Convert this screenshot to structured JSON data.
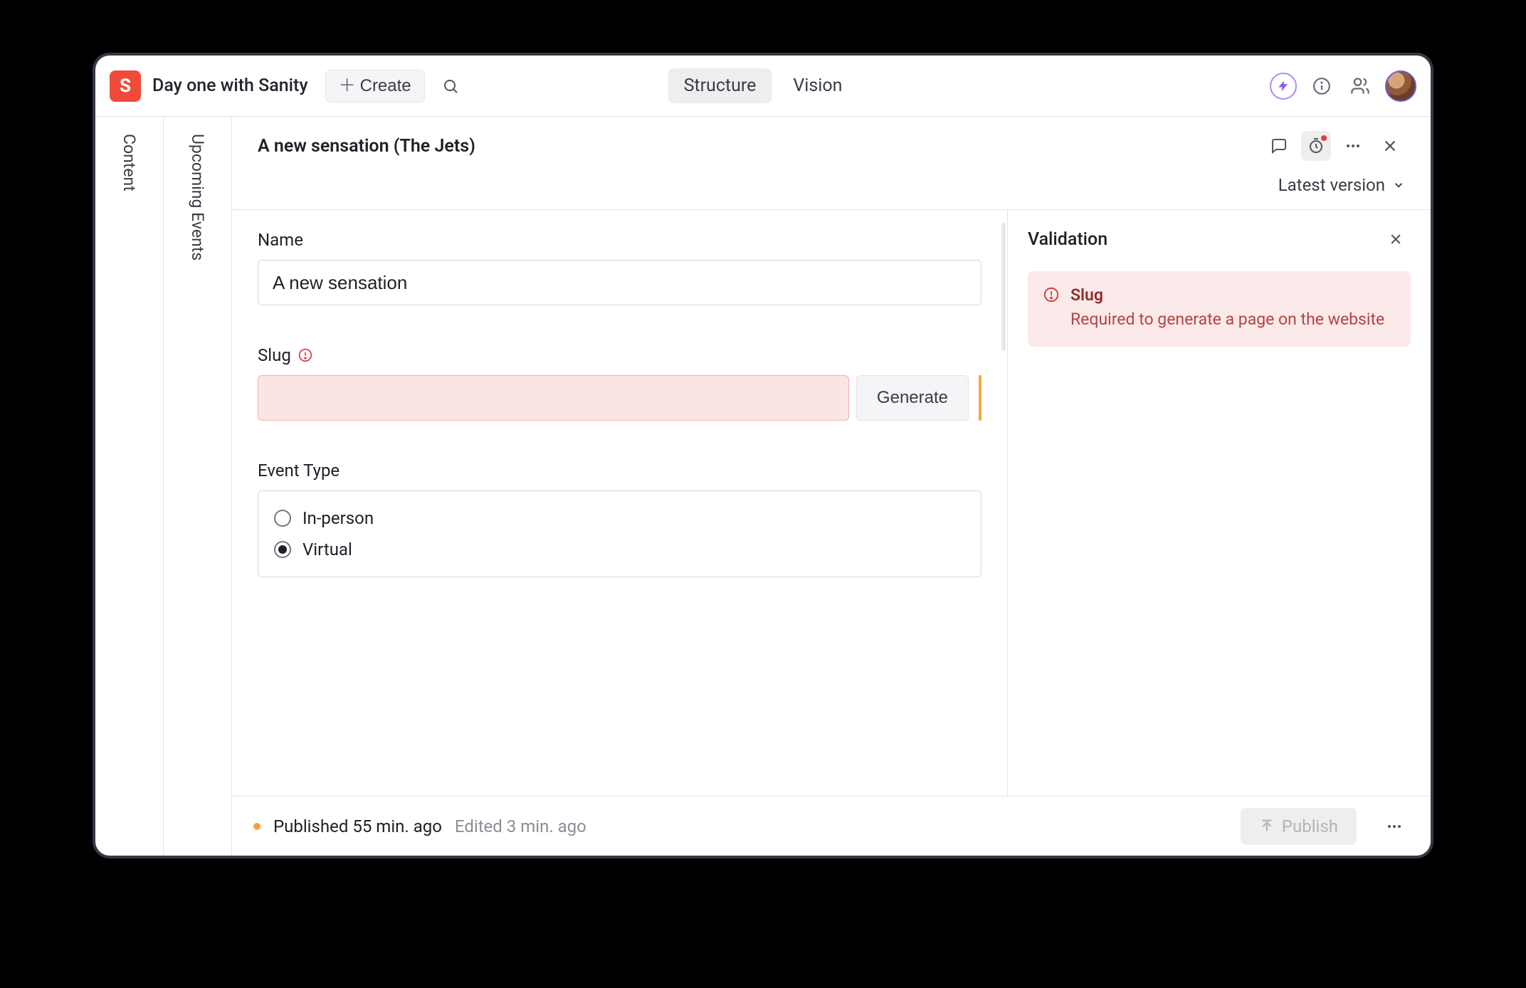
{
  "header": {
    "app_title": "Day one with Sanity",
    "create_label": "Create",
    "tabs": {
      "structure": "Structure",
      "vision": "Vision"
    }
  },
  "rails": {
    "content": "Content",
    "upcoming": "Upcoming Events"
  },
  "document": {
    "title": "A new sensation (The Jets)",
    "version_label": "Latest version"
  },
  "form": {
    "name_label": "Name",
    "name_value": "A new sensation",
    "slug_label": "Slug",
    "slug_value": "",
    "generate_label": "Generate",
    "event_type_label": "Event Type",
    "event_types": {
      "in_person": "In-person",
      "virtual": "Virtual"
    },
    "event_type_selected": "virtual"
  },
  "validation": {
    "heading": "Validation",
    "items": [
      {
        "field": "Slug",
        "message": "Required to generate a page on the website"
      }
    ]
  },
  "footer": {
    "published_text": "Published 55 min. ago",
    "edited_text": "Edited 3 min. ago",
    "publish_label": "Publish"
  }
}
